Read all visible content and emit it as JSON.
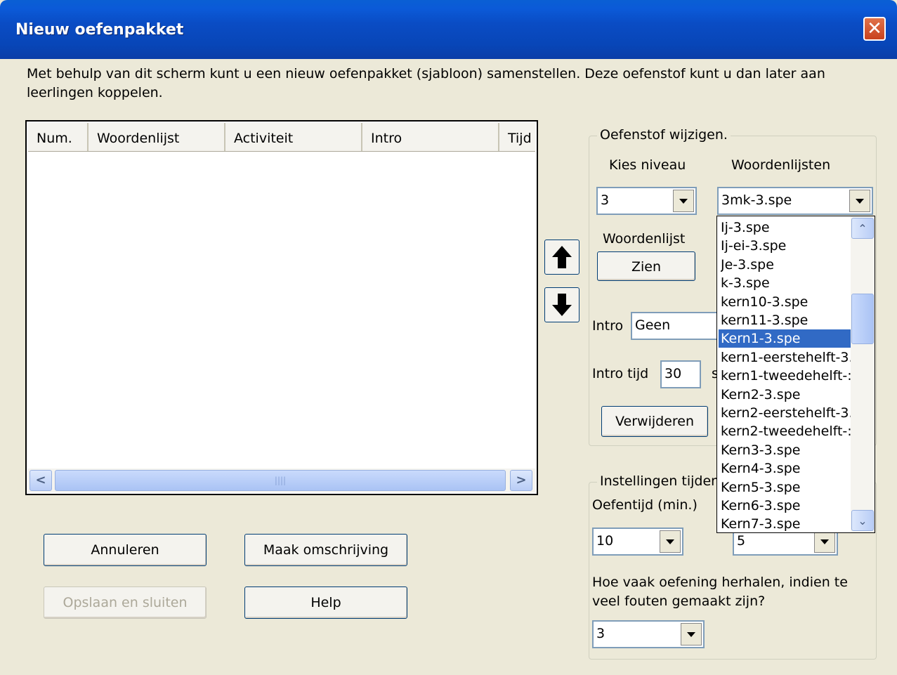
{
  "window": {
    "title": "Nieuw oefenpakket"
  },
  "description": "Met behulp van dit scherm kunt u een nieuw oefenpakket (sjabloon) samenstellen. Deze oefenstof kunt u dan later aan leerlingen koppelen.",
  "table": {
    "columns": [
      "Num.",
      "Woordenlijst",
      "Activiteit",
      "Intro",
      "Tijd"
    ]
  },
  "buttons": {
    "annuleren": "Annuleren",
    "maak_omschrijving": "Maak omschrijving",
    "opslaan": "Opslaan en sluiten",
    "help": "Help"
  },
  "oefenstof": {
    "group_label": "Oefenstof wijzigen.",
    "kies_niveau_label": "Kies niveau",
    "woordenlijsten_label": "Woordenlijsten",
    "niveau_value": "3",
    "woordenlijst_value": "3mk-3.spe",
    "woordenlijst_btn_label": "Woordenlijst",
    "zien": "Zien",
    "intro_label": "Intro",
    "intro_value": "Geen",
    "intro_tijd_label": "Intro tijd",
    "intro_tijd_value": "30",
    "intro_tijd_unit": "s",
    "verwijderen": "Verwijderen"
  },
  "woordenlijst_options": [
    "Ij-3.spe",
    "Ij-ei-3.spe",
    "Je-3.spe",
    "k-3.spe",
    "kern10-3.spe",
    "kern11-3.spe",
    "Kern1-3.spe",
    "kern1-eerstehelft-3.",
    "kern1-tweedehelft-:",
    "Kern2-3.spe",
    "kern2-eerstehelft-3.",
    "kern2-tweedehelft-:",
    "Kern3-3.spe",
    "Kern4-3.spe",
    "Kern5-3.spe",
    "Kern6-3.spe",
    "Kern7-3.spe"
  ],
  "selected_option": "Kern1-3.spe",
  "instellingen": {
    "group_label": "Instellingen tijden",
    "oefentijd_label": "Oefentijd (min.)",
    "oefentijd_value": "10",
    "second_value": "5",
    "herhalen_label": "Hoe vaak oefening herhalen, indien te veel fouten gemaakt zijn?",
    "herhalen_value": "3"
  },
  "colors": {
    "titlebar": "#0a4cc4",
    "selection": "#316ac5",
    "face": "#ece9d8"
  }
}
